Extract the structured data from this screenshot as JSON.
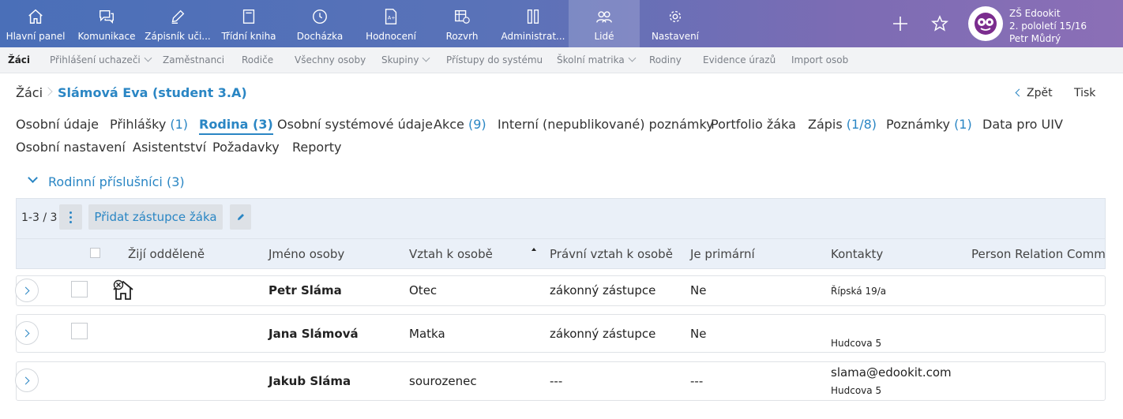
{
  "topnav": [
    {
      "label": "Hlavní panel",
      "icon": "home-icon"
    },
    {
      "label": "Komunikace",
      "icon": "chat-icon"
    },
    {
      "label": "Zápisník uči...",
      "icon": "pencil-icon"
    },
    {
      "label": "Třídní kniha",
      "icon": "book-icon"
    },
    {
      "label": "Docházka",
      "icon": "clock-icon"
    },
    {
      "label": "Hodnocení",
      "icon": "grade-icon"
    },
    {
      "label": "Rozvrh",
      "icon": "timetable-icon"
    },
    {
      "label": "Administrat...",
      "icon": "admin-icon"
    },
    {
      "label": "Lidé",
      "icon": "people-icon",
      "active": true
    },
    {
      "label": "Nastavení",
      "icon": "gear-icon"
    }
  ],
  "org": {
    "name": "ZŠ Edookit",
    "period": "2. pololetí 15/16",
    "user": "Petr Můdrý"
  },
  "subnav": [
    {
      "label": "Žáci",
      "active": true
    },
    {
      "label": "Přihlášení uchazeči"
    },
    {
      "label": "Zaměstnanci"
    },
    {
      "label": "Rodiče"
    },
    {
      "label": "Všechny osoby"
    },
    {
      "label": "Skupiny"
    },
    {
      "label": "Přístupy do systému"
    },
    {
      "label": "Školní matrika"
    },
    {
      "label": "Rodiny"
    },
    {
      "label": "Evidence úrazů"
    },
    {
      "label": "Import osob"
    }
  ],
  "breadcrumb": {
    "root": "Žáci",
    "current": "Slámová Eva  (student 3.A)"
  },
  "actions": {
    "back": "Zpět",
    "print": "Tisk"
  },
  "tabs": [
    {
      "label": "Osobní údaje",
      "count": ""
    },
    {
      "label": "Přihlášky",
      "count": "(1)"
    },
    {
      "label": "Rodina",
      "count": "(3)",
      "active": true
    },
    {
      "label": "Osobní systémové údaje",
      "count": ""
    },
    {
      "label": "Akce",
      "count": "(9)"
    },
    {
      "label": "Interní (nepublikované) poznámky",
      "count": ""
    },
    {
      "label": "Portfolio žáka",
      "count": ""
    },
    {
      "label": "Zápis",
      "count": "(1/8)"
    },
    {
      "label": "Poznámky",
      "count": "(1)"
    },
    {
      "label": "Data pro UIV",
      "count": ""
    },
    {
      "label": "Osobní nastavení",
      "count": ""
    },
    {
      "label": "Asistentství",
      "count": ""
    },
    {
      "label": "Požadavky",
      "count": ""
    },
    {
      "label": "Reporty",
      "count": ""
    }
  ],
  "section": {
    "title": "Rodinní příslušníci (3)"
  },
  "grid": {
    "count": "1-3 / 3",
    "add_label": "Přidat zástupce žáka",
    "headers": [
      "Žijí odděleně",
      "Jméno osoby",
      "Vztah k osobě",
      "Právní vztah k osobě",
      "Je primární",
      "Kontakty",
      "Person Relation Comme"
    ],
    "rows": [
      {
        "name": "Petr Sláma",
        "relation": "Otec",
        "legal": "zákonný zástupce",
        "primary": "Ne",
        "contact_email": "",
        "contact_addr": "Řípská 19/a",
        "separate": true,
        "checkbox": true
      },
      {
        "name": "Jana Slámová",
        "relation": "Matka",
        "legal": "zákonný zástupce",
        "primary": "Ne",
        "contact_email": "",
        "contact_addr": "Hudcova 5",
        "separate": false,
        "checkbox": true
      },
      {
        "name": "Jakub Sláma",
        "relation": "sourozenec",
        "legal": "---",
        "primary": "---",
        "contact_email": "slama@edookit.com",
        "contact_addr": "Hudcova 5",
        "separate": false,
        "checkbox": false
      }
    ]
  }
}
